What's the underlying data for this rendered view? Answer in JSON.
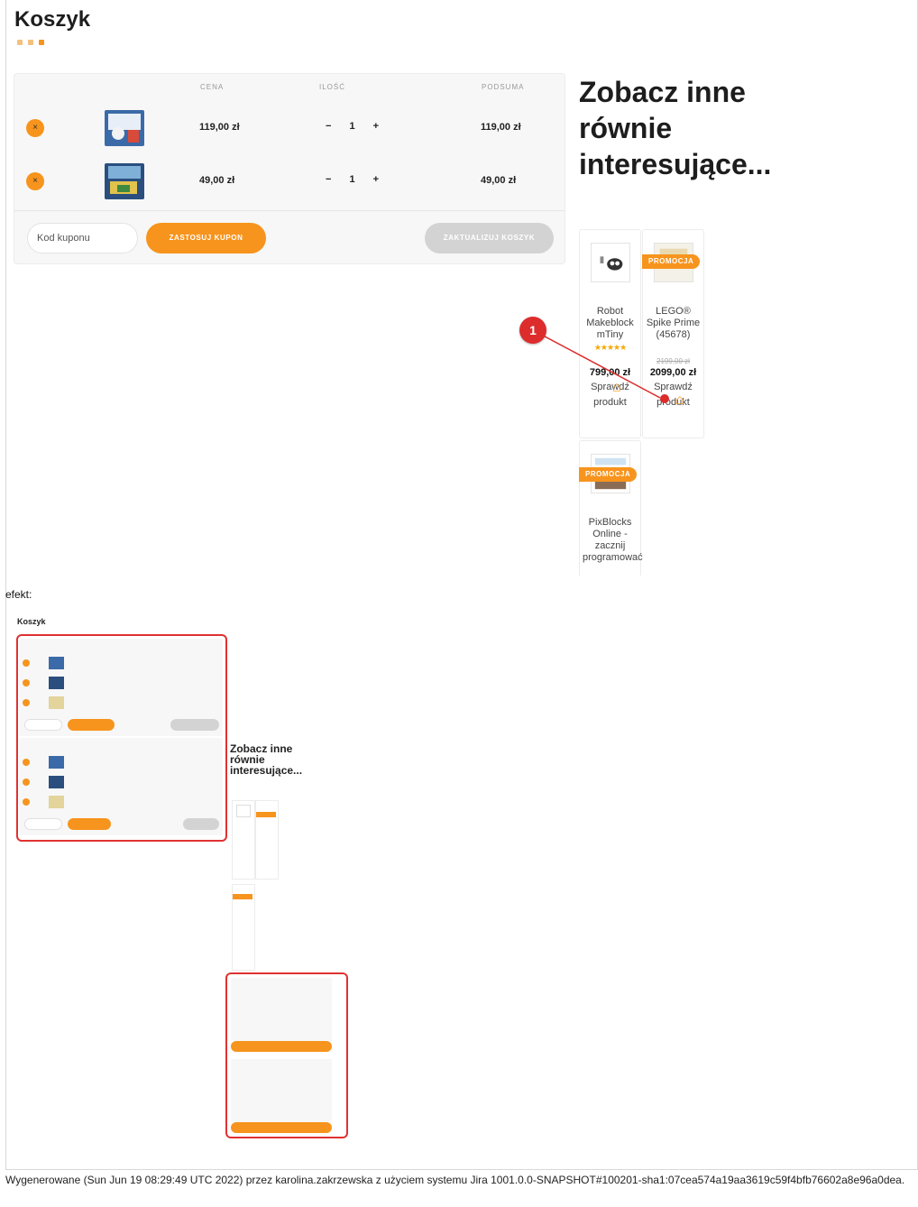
{
  "page": {
    "title": "Koszyk",
    "efekt_label": "efekt:",
    "footer": "Wygenerowane (Sun Jun 19 08:29:49 UTC 2022) przez karolina.zakrzewska z użyciem systemu Jira 1001.0.0-SNAPSHOT#100201-sha1:07cea574a19aa3619c59f4bfb76602a8e96a0dea."
  },
  "cart": {
    "headers": {
      "price": "CENA",
      "qty": "ILOŚĆ",
      "subtotal": "PODSUMA"
    },
    "items": [
      {
        "remove": "×",
        "price": "119,00 zł",
        "minus": "−",
        "qty": "1",
        "plus": "+",
        "subtotal": "119,00 zł"
      },
      {
        "remove": "×",
        "price": "49,00 zł",
        "minus": "−",
        "qty": "1",
        "plus": "+",
        "subtotal": "49,00 zł"
      }
    ],
    "coupon_placeholder": "Kod kuponu",
    "apply_label": "ZASTOSUJ KUPON",
    "update_label": "ZAKTUALIZUJ KOSZYK"
  },
  "related": {
    "heading": "Zobacz inne równie interesujące...",
    "products": [
      {
        "name": "Robot Makeblock mTiny",
        "stars": "★★★★★",
        "price": "799,00 zł",
        "cta": "Sprawdź produkt"
      },
      {
        "badge": "PROMOCJA",
        "name": "LEGO® Spike Prime (45678)",
        "old_price": "2199,00 zł",
        "price": "2099,00 zł",
        "cta": "Sprawdź produkt"
      },
      {
        "badge": "PROMOCJA",
        "name": "PixBlocks Online - zacznij programować"
      }
    ]
  },
  "annotation": {
    "number": "1",
    "color": "#dd2c2c"
  },
  "colors": {
    "accent": "#f7941d",
    "annotation": "#e03131"
  }
}
